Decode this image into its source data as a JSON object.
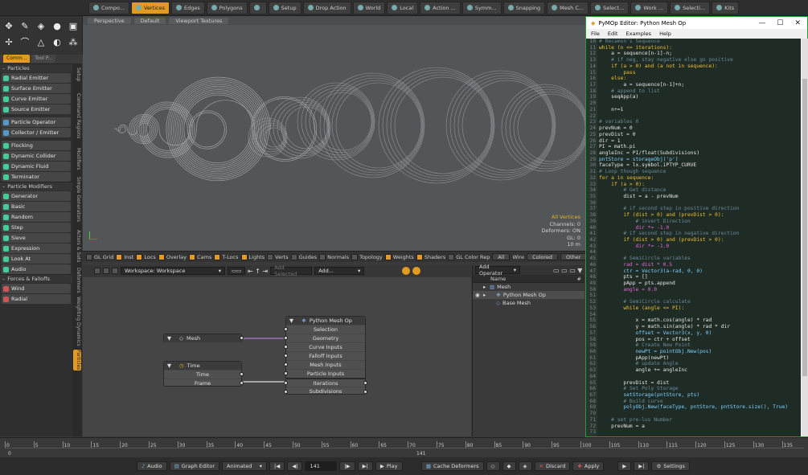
{
  "topbar": {
    "items": [
      {
        "label": "Compo...",
        "on": false
      },
      {
        "label": "Vertices",
        "on": true
      },
      {
        "label": "Edges",
        "on": false
      },
      {
        "label": "Polygons",
        "on": false
      },
      {
        "label": "",
        "on": false
      },
      {
        "label": "Setup",
        "on": false
      },
      {
        "label": "Drop Action",
        "on": false
      },
      {
        "label": "World",
        "on": false
      },
      {
        "label": "Local",
        "on": false
      },
      {
        "label": "Action ...",
        "on": false
      },
      {
        "label": "Symm...",
        "on": false
      },
      {
        "label": "Snapping",
        "on": false
      },
      {
        "label": "Mesh C...",
        "on": false
      },
      {
        "label": "Select...",
        "on": false
      },
      {
        "label": "Work ...",
        "on": false
      },
      {
        "label": "Selecti...",
        "on": false
      },
      {
        "label": "Kits",
        "on": false
      }
    ]
  },
  "left_tabs": [
    "Comm...",
    "Tool P..."
  ],
  "left_panel": {
    "sections": [
      {
        "header": "Particles",
        "items": [
          {
            "label": "Radial Emitter",
            "color": "green"
          },
          {
            "label": "Surface Emitter",
            "color": "green"
          },
          {
            "label": "Curve Emitter",
            "color": "green"
          },
          {
            "label": "Source Emitter",
            "color": "green"
          }
        ]
      },
      {
        "header": "",
        "items": [
          {
            "label": "Particle Operator",
            "color": "blue"
          },
          {
            "label": "Collector / Emitter",
            "color": "blue"
          }
        ]
      },
      {
        "header": "",
        "items": [
          {
            "label": "Flocking",
            "color": "green"
          },
          {
            "label": "Dynamic Collider",
            "color": "green"
          },
          {
            "label": "Dynamic Fluid",
            "color": "green"
          },
          {
            "label": "Terminator",
            "color": "green"
          }
        ]
      },
      {
        "header": "Particle Modifiers",
        "items": [
          {
            "label": "Generator",
            "color": "green"
          },
          {
            "label": "Basic",
            "color": "green"
          },
          {
            "label": "Random",
            "color": "green"
          },
          {
            "label": "Step",
            "color": "green"
          },
          {
            "label": "Sieve",
            "color": "green"
          },
          {
            "label": "Expression",
            "color": "green"
          },
          {
            "label": "Look At",
            "color": "green"
          },
          {
            "label": "Audio",
            "color": "green"
          }
        ]
      },
      {
        "header": "Forces & Falloffs",
        "items": [
          {
            "label": "Wind",
            "color": "red"
          },
          {
            "label": "Radial",
            "color": "red"
          }
        ]
      }
    ]
  },
  "side_tabs": [
    "Setup",
    "Command Regions",
    "Modifiers",
    "Simple Generators",
    "Actors & Sets",
    "Deformers",
    "Weighting",
    "Dynamics",
    "Particles"
  ],
  "viewport": {
    "header": [
      "Perspective",
      "Default",
      "Viewport Textures"
    ],
    "info": [
      {
        "text": "All Vertices",
        "yellow": true
      },
      {
        "text": "Channels: 0",
        "yellow": false
      },
      {
        "text": "Deformers: ON",
        "yellow": false
      },
      {
        "text": "GL: 0",
        "yellow": false
      },
      {
        "text": "10 m",
        "yellow": false
      }
    ]
  },
  "toggles": {
    "items": [
      {
        "label": "GL Grid",
        "on": false
      },
      {
        "label": "Inst",
        "on": true
      },
      {
        "label": "Locs",
        "on": true
      },
      {
        "label": "Overlay",
        "on": true
      },
      {
        "label": "Cams",
        "on": true
      },
      {
        "label": "T-Locs",
        "on": true
      },
      {
        "label": "Lights",
        "on": true
      },
      {
        "label": "Verts",
        "on": false
      },
      {
        "label": "Guides",
        "on": false
      },
      {
        "label": "Normals",
        "on": false
      },
      {
        "label": "Topology",
        "on": false
      },
      {
        "label": "Weights",
        "on": true
      },
      {
        "label": "Shaders",
        "on": true
      },
      {
        "label": "GL Color Rep",
        "on": false
      }
    ],
    "all": "All",
    "wire_label": "Wire",
    "wire": "Colored",
    "other": "Other"
  },
  "schematic": {
    "workspace": "Workspace: Workspace",
    "add_selected": "Add Selected",
    "add": "Add...",
    "nodes": {
      "mesh": {
        "title": "Mesh"
      },
      "time": {
        "title": "Time",
        "rows": [
          "Time",
          "Frame"
        ]
      },
      "pymop": {
        "title": "Python Mesh Op",
        "rows": [
          "Selection",
          "Geometry",
          "Curve Inputs",
          "Falloff Inputs",
          "Mesh Inputs",
          "Particle Inputs",
          "Iterations",
          "Subdivisions"
        ]
      }
    }
  },
  "outliner": {
    "add_operator": "Add Operator",
    "col": "Name",
    "rows": [
      {
        "label": "Mesh",
        "indent": 0
      },
      {
        "label": "Python Mesh Op",
        "indent": 1
      },
      {
        "label": "Base Mesh",
        "indent": 1
      }
    ]
  },
  "timeline": {
    "ticks": [
      "0",
      "5",
      "10",
      "15",
      "20",
      "25",
      "30",
      "35",
      "40",
      "45",
      "50",
      "55",
      "60",
      "65",
      "70",
      "75",
      "80",
      "85",
      "90",
      "95",
      "100",
      "105",
      "110",
      "115",
      "120",
      "125",
      "130",
      "135"
    ],
    "start": "0",
    "current": "141"
  },
  "bottombar": {
    "audio": "Audio",
    "graph_editor": "Graph Editor",
    "animated": "Animated",
    "frame": "141",
    "play": "Play",
    "cache": "Cache Deformers",
    "discard": "Discard",
    "apply": "Apply",
    "settings": "Settings"
  },
  "editor": {
    "title": "PyMOp Editor: Python Mesh Op",
    "menu": [
      "File",
      "Edit",
      "Examples",
      "Help"
    ],
    "line_numbers": [
      "10",
      "11",
      "12",
      "13",
      "14",
      "15",
      "16",
      "17",
      "18",
      "19",
      "20",
      "21",
      "22",
      "23",
      "24",
      "25",
      "26",
      "27",
      "28",
      "29",
      "30",
      "31",
      "32",
      "33",
      "34",
      "35",
      "36",
      "37",
      "38",
      "39",
      "40",
      "41",
      "42",
      "43",
      "44",
      "45",
      "46",
      "47",
      "48",
      "49",
      "50",
      "51",
      "52",
      "53",
      "54",
      "55",
      "56",
      "57",
      "58",
      "59",
      "60",
      "61",
      "62",
      "63",
      "64",
      "65",
      "66",
      "67",
      "68",
      "69",
      "70",
      "71",
      "72",
      "73"
    ],
    "lines": [
      {
        "t": "# Recamon's Sequence",
        "k": "c"
      },
      {
        "t": "while (n <= iterations):",
        "k": "k"
      },
      {
        "t": "    a = sequence[n-1]-n;",
        "k": ""
      },
      {
        "t": "    # if neg, stay negative else go positive",
        "k": "c"
      },
      {
        "t": "    if (a > 0) and (a not in sequence):",
        "k": "k"
      },
      {
        "t": "        pass",
        "k": "k"
      },
      {
        "t": "    else:",
        "k": "k"
      },
      {
        "t": "        a = sequence[n-1]+n;",
        "k": ""
      },
      {
        "t": "    # append to list",
        "k": "c"
      },
      {
        "t": "    seqApp(a)",
        "k": ""
      },
      {
        "t": "",
        "k": ""
      },
      {
        "t": "    n+=1",
        "k": ""
      },
      {
        "t": "",
        "k": ""
      },
      {
        "t": "# variables 0",
        "k": "c"
      },
      {
        "t": "prevNum = 0",
        "k": ""
      },
      {
        "t": "prevDist = 0",
        "k": ""
      },
      {
        "t": "dir = 1",
        "k": ""
      },
      {
        "t": "PI = math.pi",
        "k": ""
      },
      {
        "t": "angleInc = PI/float(Subdivisions)",
        "k": ""
      },
      {
        "t": "pntStore = storageObj('p')",
        "k": "f"
      },
      {
        "t": "faceType = lx.symbol.iPTYP_CURVE",
        "k": ""
      },
      {
        "t": "# Loop though sequence",
        "k": "c"
      },
      {
        "t": "for a in sequence:",
        "k": "k"
      },
      {
        "t": "    if (a > 0):",
        "k": "k"
      },
      {
        "t": "        # Get distance",
        "k": "c"
      },
      {
        "t": "        dist = a - prevNum",
        "k": ""
      },
      {
        "t": "",
        "k": ""
      },
      {
        "t": "        # if second step in positive direction",
        "k": "c"
      },
      {
        "t": "        if (dist > 0) and (prevDist > 0):",
        "k": "k"
      },
      {
        "t": "            # invert Direction",
        "k": "c"
      },
      {
        "t": "            dir *= -1.0",
        "k": "n"
      },
      {
        "t": "        # if second step in negative direction",
        "k": "c"
      },
      {
        "t": "        if (dist > 0) and (prevDist > 0):",
        "k": "k"
      },
      {
        "t": "            dir *= -1.0",
        "k": "n"
      },
      {
        "t": "",
        "k": ""
      },
      {
        "t": "        # SemiCircle variables",
        "k": "c"
      },
      {
        "t": "        rad = dist * 0.5",
        "k": "n"
      },
      {
        "t": "        ctr = Vector3(a-rad, 0, 0)",
        "k": "f"
      },
      {
        "t": "        pts = []",
        "k": ""
      },
      {
        "t": "        pApp = pts.append",
        "k": ""
      },
      {
        "t": "        angle = 0.0",
        "k": "n"
      },
      {
        "t": "",
        "k": ""
      },
      {
        "t": "        # SemiCircle calculate",
        "k": "c"
      },
      {
        "t": "        while (angle <= PI):",
        "k": "k"
      },
      {
        "t": "",
        "k": ""
      },
      {
        "t": "            x = math.cos(angle) * rad",
        "k": ""
      },
      {
        "t": "            y = math.sin(angle) * rad * dir",
        "k": ""
      },
      {
        "t": "            offset = Vector3(x, y, 0)",
        "k": "f"
      },
      {
        "t": "            pos = ctr + offset",
        "k": ""
      },
      {
        "t": "            # Create New Point",
        "k": "c"
      },
      {
        "t": "            newPt = pointObj.New(pos)",
        "k": "f"
      },
      {
        "t": "            pApp(newPt)",
        "k": ""
      },
      {
        "t": "            # update Angle",
        "k": "c"
      },
      {
        "t": "            angle += angleInc",
        "k": ""
      },
      {
        "t": "",
        "k": ""
      },
      {
        "t": "        prevDist = dist",
        "k": ""
      },
      {
        "t": "        # Set Poly Storage",
        "k": "c"
      },
      {
        "t": "        setStorage(pntStore, pts)",
        "k": "f"
      },
      {
        "t": "        # Build curve",
        "k": "c"
      },
      {
        "t": "        polyObj.New(faceType, pntStore, pntStore.size(), True)",
        "k": "f"
      },
      {
        "t": "",
        "k": ""
      },
      {
        "t": "    # set pre-lus Number",
        "k": "c"
      },
      {
        "t": "    prevNum = a",
        "k": ""
      },
      {
        "t": "",
        "k": ""
      }
    ]
  },
  "colors": {
    "accent": "#e29a22",
    "editor_border": "#1aa332",
    "code_bg": "#1f2b25"
  }
}
